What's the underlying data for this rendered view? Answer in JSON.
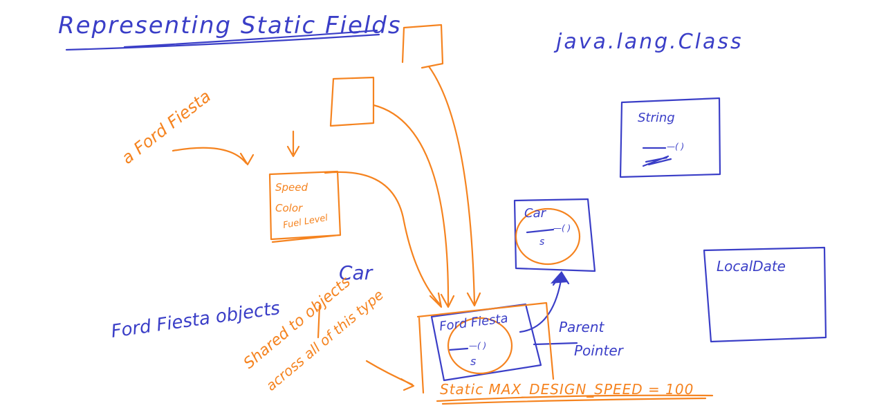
{
  "title": "Representing Static Fields",
  "header_label": "java.lang.Class",
  "labels": {
    "a_ford_fiesta": "a Ford Fiesta",
    "ford_fiesta_objects": "Ford Fiesta objects",
    "car": "Car",
    "shared_note": "Shared to objects",
    "shared_note_2": "across all of this type",
    "parent": "Parent",
    "pointer": "Pointer",
    "static_field": "Static MAX_DESIGN_SPEED = 100"
  },
  "boxes": {
    "string_class": {
      "title": "String",
      "fields": "—( )",
      "static": "s"
    },
    "car_class": {
      "title": "Car",
      "fields": "—( )",
      "static": "s"
    },
    "localdate_class": {
      "title": "LocalDate"
    },
    "ford_fiesta_class": {
      "title": "Ford Fiesta",
      "fields": "—( )",
      "static": "s"
    },
    "instance_box": {
      "line1": "Speed",
      "line2": "Color",
      "line3": "Fuel Level"
    }
  },
  "colors": {
    "blue_ink": "#3a3ec7",
    "orange_ink": "#f5831f"
  }
}
